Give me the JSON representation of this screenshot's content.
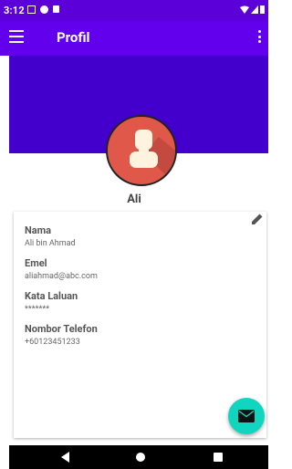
{
  "status_bar": {
    "time": "3:12",
    "icons": [
      "notification-square-icon",
      "notification-circle-icon",
      "notification-lock-icon"
    ],
    "right_icons": [
      "wifi-icon",
      "signal-icon",
      "battery-icon"
    ]
  },
  "toolbar": {
    "title": "Profil",
    "menu_icon": "hamburger-menu-icon",
    "overflow_icon": "more-vert-icon",
    "background": "#6200ee"
  },
  "header": {
    "background": "#4300cc"
  },
  "profile": {
    "display_name": "Ali",
    "avatar_icon": "person-avatar-icon"
  },
  "fields": [
    {
      "label": "Nama",
      "value": "Ali bin Ahmad"
    },
    {
      "label": "Emel",
      "value": "aliahmad@abc.com"
    },
    {
      "label": "Kata Laluan",
      "value": "*******"
    },
    {
      "label": "Nombor Telefon",
      "value": "+60123451233"
    }
  ],
  "card": {
    "edit_icon": "pencil-edit-icon"
  },
  "fab": {
    "icon": "mail-icon",
    "color": "#10d6bf"
  },
  "nav": {
    "icons": [
      "back-icon",
      "home-icon",
      "recents-icon"
    ]
  }
}
